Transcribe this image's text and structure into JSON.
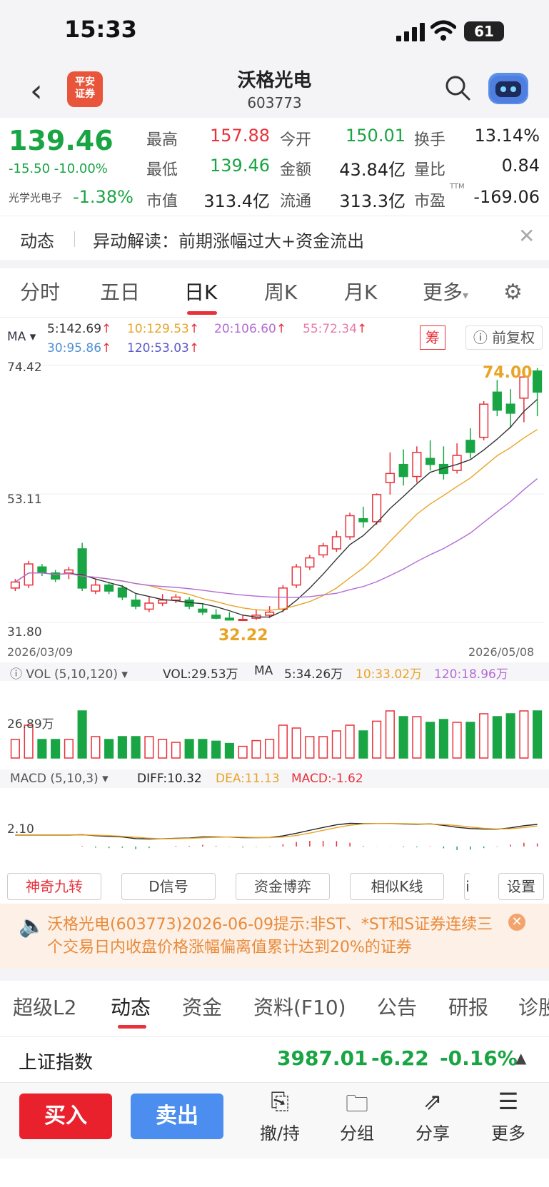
{
  "status_bar": {
    "time": "15:33",
    "battery": "61"
  },
  "header": {
    "stock_name": "沃格光电",
    "stock_code": "603773",
    "broker_logo": "平安\n证券"
  },
  "quote": {
    "price": "139.46",
    "change": "-15.50",
    "change_pct": "-10.00%",
    "sector": "光学光电子",
    "sector_pct": "-1.38%",
    "high_label": "最高",
    "high": "157.88",
    "low_label": "最低",
    "low": "139.46",
    "mktcap_label": "市值",
    "mktcap": "313.4亿",
    "open_label": "今开",
    "open": "150.01",
    "amount_label": "金额",
    "amount": "43.84亿",
    "float_label": "流通",
    "float": "313.3亿",
    "turnover_label": "换手",
    "turnover": "13.14%",
    "volratio_label": "量比",
    "volratio": "0.84",
    "pe_label": "市盈",
    "pe_sup": "TTM",
    "pe": "-169.06"
  },
  "news": {
    "tag": "动态",
    "text": "异动解读：前期涨幅过大+资金流出"
  },
  "ktabs": [
    "分时",
    "五日",
    "日K",
    "周K",
    "月K",
    "更多"
  ],
  "ma_legend": {
    "label": "MA",
    "ma5": "5:142.69",
    "ma10": "10:129.53",
    "ma20": "20:106.60",
    "ma55": "55:72.34",
    "ma30": "30:95.86",
    "ma120": "120:53.03",
    "chip_label": "筹",
    "adjust_label": "前复权"
  },
  "kchart": {
    "y_top": "74.42",
    "y_mid": "53.11",
    "y_bot": "31.80",
    "date_start": "2026/03/09",
    "date_end": "2026/05/08",
    "high_label": "74.00",
    "low_label": "32.22"
  },
  "vol_legend": {
    "label": "VOL (5,10,120)",
    "vol": "VOL:29.53万",
    "ma": "MA",
    "ma5": "5:34.26万",
    "ma10": "10:33.02万",
    "ma120": "120:18.96万",
    "y_label": "26.89万"
  },
  "macd_legend": {
    "label": "MACD (5,10,3)",
    "diff": "DIFF:10.32",
    "dea": "DEA:11.13",
    "macd": "MACD:-1.62",
    "y_label": "2.10"
  },
  "tools": [
    "神奇九转",
    "D信号",
    "资金博弈",
    "相似K线",
    "设置"
  ],
  "alert": {
    "text": "沃格光电(603773)2026-06-09提示:非ST、*ST和S证券连续三个交易日内收盘价格涨幅偏离值累计达到20%的证券"
  },
  "btabs": [
    "超级L2",
    "动态",
    "资金",
    "资料(F10)",
    "公告",
    "研报",
    "诊股"
  ],
  "index": {
    "name": "上证指数",
    "value": "3987.01",
    "change": "-6.22",
    "pct": "-0.16%"
  },
  "toolbar": {
    "buy": "买入",
    "sell": "卖出",
    "hold": "撤/持",
    "group": "分组",
    "share": "分享",
    "more": "更多"
  },
  "chart_data": {
    "type": "candlestick",
    "candles": [
      [
        37.5,
        38.5,
        37.0,
        39.0
      ],
      [
        38.0,
        41.5,
        37.5,
        42.0
      ],
      [
        41.0,
        40.0,
        39.5,
        41.5
      ],
      [
        40.0,
        39.0,
        38.5,
        40.5
      ],
      [
        40.0,
        40.5,
        39.0,
        41.0
      ],
      [
        44.0,
        37.5,
        37.0,
        45.0
      ],
      [
        37.0,
        38.0,
        36.5,
        39.0
      ],
      [
        38.0,
        37.0,
        36.5,
        38.5
      ],
      [
        37.5,
        36.0,
        35.5,
        38.0
      ],
      [
        35.5,
        34.5,
        34.0,
        36.5
      ],
      [
        34.0,
        35.0,
        33.5,
        36.0
      ],
      [
        35.0,
        35.5,
        34.5,
        36.5
      ],
      [
        35.5,
        36.0,
        35.0,
        36.5
      ],
      [
        35.5,
        34.5,
        34.0,
        36.0
      ],
      [
        34.0,
        33.5,
        33.0,
        35.0
      ],
      [
        33.0,
        32.5,
        32.3,
        34.0
      ],
      [
        32.5,
        32.2,
        32.2,
        33.5
      ],
      [
        32.3,
        32.3,
        32.2,
        33.0
      ],
      [
        32.5,
        33.0,
        32.2,
        34.0
      ],
      [
        33.0,
        33.5,
        32.5,
        34.5
      ],
      [
        34.0,
        37.5,
        33.5,
        38.0
      ],
      [
        38.0,
        41.0,
        37.5,
        41.5
      ],
      [
        41.0,
        42.5,
        40.5,
        43.0
      ],
      [
        43.0,
        44.5,
        42.5,
        45.0
      ],
      [
        44.0,
        46.0,
        43.5,
        47.0
      ],
      [
        46.0,
        49.5,
        45.5,
        50.0
      ],
      [
        49.0,
        48.5,
        47.5,
        51.0
      ],
      [
        48.5,
        53.0,
        48.0,
        53.2
      ],
      [
        55.0,
        56.5,
        53.0,
        60.0
      ],
      [
        58.0,
        56.0,
        54.5,
        60.5
      ],
      [
        56.0,
        60.0,
        55.0,
        61.0
      ],
      [
        59.0,
        58.0,
        57.0,
        62.0
      ],
      [
        58.0,
        56.5,
        55.5,
        61.0
      ],
      [
        57.0,
        59.5,
        56.5,
        61.5
      ],
      [
        62.0,
        60.0,
        59.0,
        64.0
      ],
      [
        62.5,
        68.0,
        62.0,
        68.5
      ],
      [
        70.0,
        67.0,
        66.0,
        72.0
      ],
      [
        68.0,
        66.5,
        64.0,
        70.5
      ],
      [
        69.0,
        72.5,
        65.0,
        74.0
      ],
      [
        73.5,
        70.0,
        66.0,
        74.0
      ]
    ],
    "y_range": [
      31.8,
      74.42
    ],
    "date_range": [
      "2026/03/09",
      "2026/05/08"
    ],
    "macd_y_label": 2.1,
    "vol_y_label": "26.89万"
  }
}
